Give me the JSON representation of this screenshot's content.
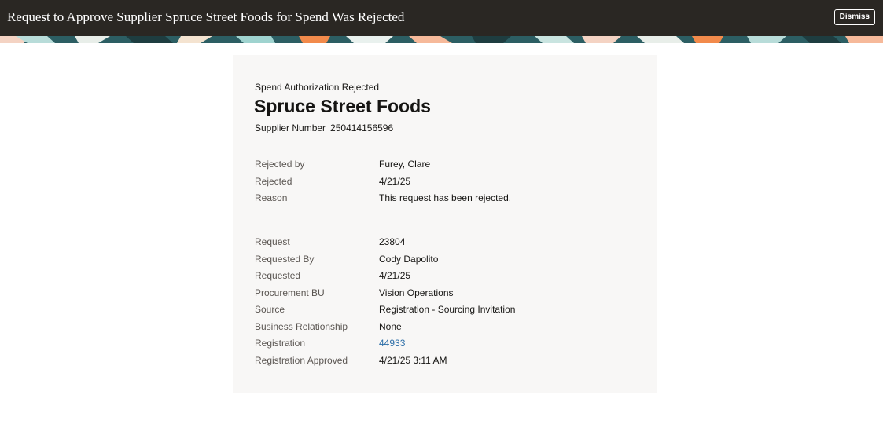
{
  "header": {
    "title": "Request to Approve Supplier Spruce Street Foods for Spend Was Rejected",
    "dismiss_label": "Dismiss"
  },
  "card": {
    "eyebrow": "Spend Authorization Rejected",
    "supplier_name": "Spruce Street Foods",
    "supplier_number_label": "Supplier Number",
    "supplier_number": "250414156596",
    "rejection": [
      {
        "label": "Rejected by",
        "value": "Furey, Clare"
      },
      {
        "label": "Rejected",
        "value": "4/21/25"
      },
      {
        "label": "Reason",
        "value": "This request has been rejected."
      }
    ],
    "request": [
      {
        "label": "Request",
        "value": "23804"
      },
      {
        "label": "Requested By",
        "value": "Cody Dapolito"
      },
      {
        "label": "Requested",
        "value": "4/21/25"
      },
      {
        "label": "Procurement BU",
        "value": "Vision Operations"
      },
      {
        "label": "Source",
        "value": "Registration - Sourcing Invitation"
      },
      {
        "label": "Business Relationship",
        "value": "None"
      },
      {
        "label": "Registration",
        "value": "44933"
      },
      {
        "label": "Registration Approved",
        "value": "4/21/25 3:11 AM"
      }
    ]
  },
  "colors": {
    "header_bg": "#2a2723",
    "card_bg": "#f8f7f6",
    "link": "#2e6fa8"
  }
}
